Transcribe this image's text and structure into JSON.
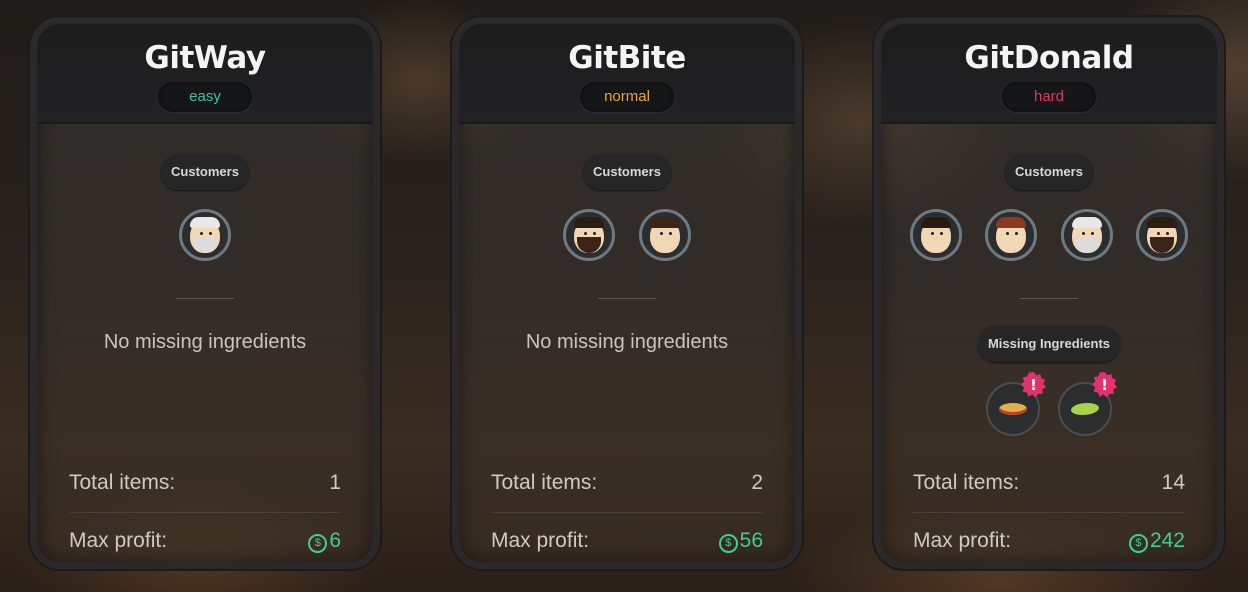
{
  "cards": [
    {
      "name": "GitWay",
      "difficulty": "easy",
      "customers_label": "Customers",
      "customers": [
        "old-man-avatar"
      ],
      "missing_text": "No missing ingredients",
      "total_items_label": "Total items:",
      "total_items": "1",
      "max_profit_label": "Max profit:",
      "max_profit": "6"
    },
    {
      "name": "GitBite",
      "difficulty": "normal",
      "customers_label": "Customers",
      "customers": [
        "bearded-man-avatar",
        "young-man-avatar"
      ],
      "missing_text": "No missing ingredients",
      "total_items_label": "Total items:",
      "total_items": "2",
      "max_profit_label": "Max profit:",
      "max_profit": "56"
    },
    {
      "name": "GitDonald",
      "difficulty": "hard",
      "customers_label": "Customers",
      "customers": [
        "young-man-avatar",
        "woman-avatar",
        "old-man-avatar",
        "bearded-man-avatar"
      ],
      "missing_label": "Missing Ingredients",
      "missing_ingredients": [
        "pasta-icon",
        "leaf-icon"
      ],
      "alert_symbol": "!",
      "total_items_label": "Total items:",
      "total_items": "14",
      "max_profit_label": "Max profit:",
      "max_profit": "242"
    }
  ],
  "colors": {
    "easy": "#3fc39b",
    "normal": "#f0a23a",
    "hard": "#e2365f",
    "profit": "#3fcf8e",
    "alert": "#e0336d"
  },
  "currency_icon": "dollar-coin-icon",
  "currency_symbol": "$"
}
